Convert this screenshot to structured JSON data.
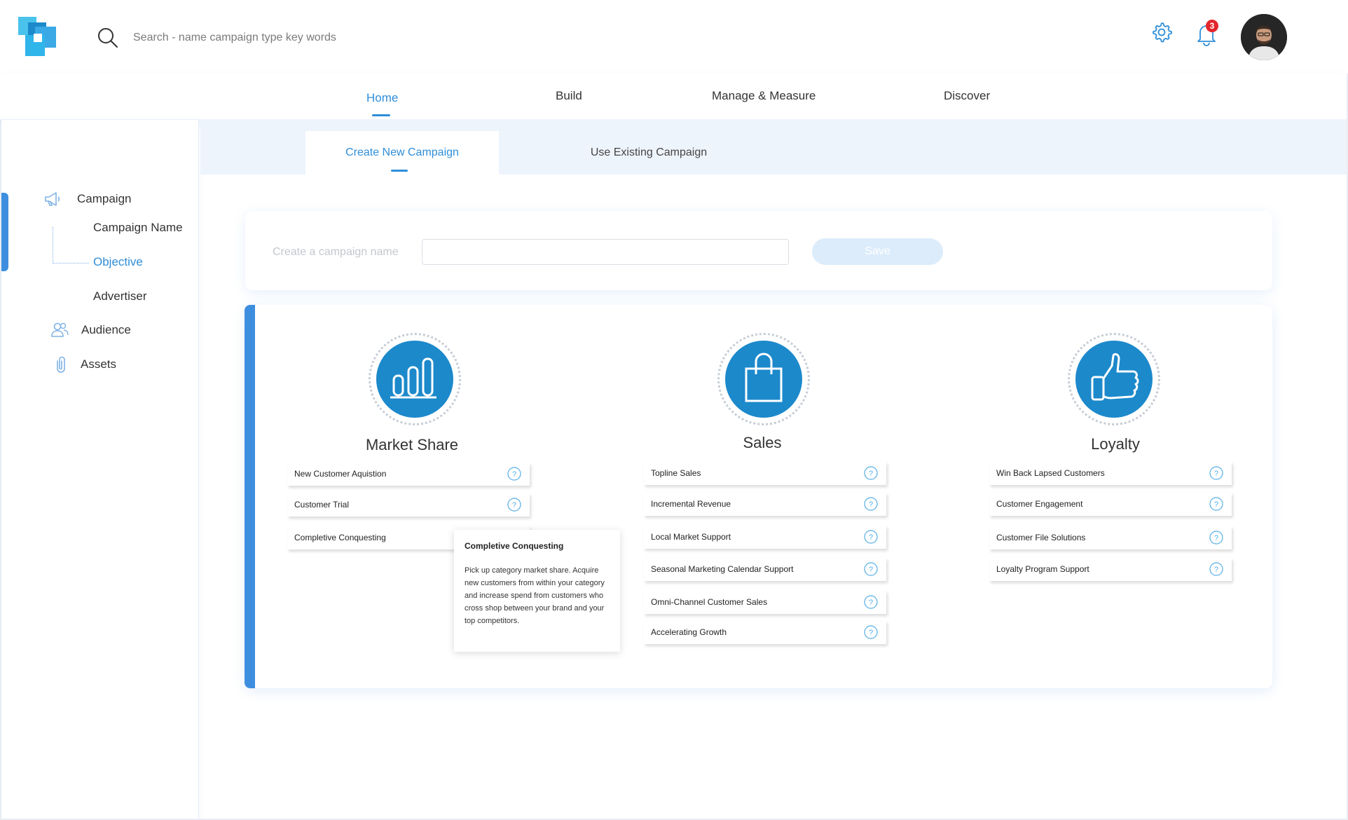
{
  "header": {
    "search_placeholder": "Search - name campaign type key words",
    "notification_count": "3"
  },
  "nav": {
    "items": [
      "Home",
      "Build",
      "Manage & Measure",
      "Discover"
    ],
    "active": "Home"
  },
  "sidebar": {
    "campaign": "Campaign",
    "campaign_name": "Campaign Name",
    "objective": "Objective",
    "advertiser": "Advertiser",
    "audience": "Audience",
    "assets": "Assets"
  },
  "subtabs": {
    "create": "Create New Campaign",
    "existing": "Use Existing Campaign"
  },
  "name_form": {
    "label": "Create a campaign name",
    "value": "",
    "save_label": "Save"
  },
  "categories": [
    {
      "title": "Market Share",
      "icon": "bar-chart-icon",
      "options": [
        "New Customer Aquistion",
        "Customer Trial",
        "Completive Conquesting"
      ]
    },
    {
      "title": "Sales",
      "icon": "shopping-bag-icon",
      "options": [
        "Topline Sales",
        "Incremental Revenue",
        "Local Market Support",
        "Seasonal Marketing Calendar Support",
        "Omni-Channel Customer Sales",
        "Accelerating Growth"
      ]
    },
    {
      "title": "Loyalty",
      "icon": "thumbs-up-icon",
      "options": [
        "Win Back Lapsed Customers",
        "Customer Engagement",
        "Customer File Solutions",
        "Loyalty Program Support"
      ]
    }
  ],
  "tooltip": {
    "title": "Completive Conquesting",
    "body": "Pick up category market share. Acquire new customers from within your category and increase spend from customers who cross shop between your brand and your top competitors."
  },
  "colors": {
    "accent": "#2f8ed9",
    "circle_fill": "#1c89cb",
    "badge": "#e2262c"
  }
}
